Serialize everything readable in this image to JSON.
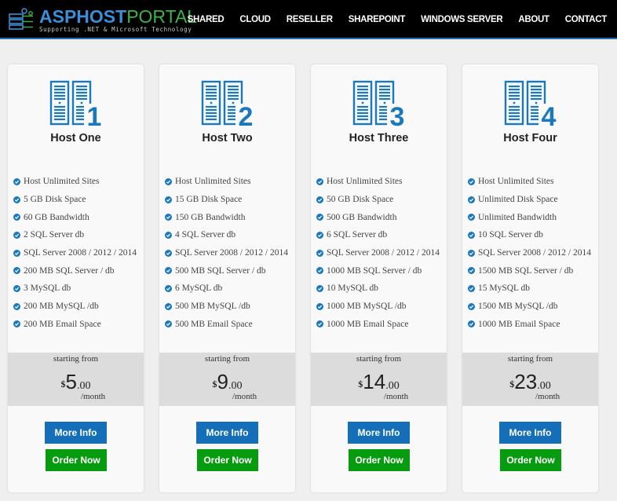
{
  "header": {
    "logo": {
      "part1": "ASPHOST",
      "part2": "PORTAL",
      "tagline": "Supporting .NET & Microsoft Technology",
      "icon": "server-gear-icon"
    },
    "nav": [
      "SHARED",
      "CLOUD",
      "RESELLER",
      "SHAREPOINT",
      "WINDOWS SERVER",
      "ABOUT",
      "CONTACT"
    ]
  },
  "colors": {
    "brand_blue": "#3a8fd8",
    "brand_green": "#3cb34a",
    "more_info_button": "#146fb8",
    "order_now_button": "#079b0f",
    "check_icon": "#1a78be"
  },
  "plans": [
    {
      "number": "1",
      "title": "Host One",
      "features": [
        "Host Unlimited Sites",
        "5 GB Disk Space",
        "60 GB Bandwidth",
        "2 SQL Server db",
        "SQL Server 2008 / 2012 / 2014",
        "200 MB SQL Server / db",
        "3 MySQL db",
        "200 MB MySQL /db",
        "200 MB Email Space"
      ],
      "starting_label": "starting from",
      "currency": "$",
      "amount": "5",
      "decimals": ".00",
      "period": "/month",
      "more_info": "More Info",
      "order_now": "Order Now"
    },
    {
      "number": "2",
      "title": "Host Two",
      "features": [
        "Host Unlimited Sites",
        "15 GB Disk Space",
        "150 GB Bandwidth",
        "4 SQL Server db",
        "SQL Server 2008 / 2012 / 2014",
        "500 MB SQL Server / db",
        "6 MySQL db",
        "500 MB MySQL /db",
        "500 MB Email Space"
      ],
      "starting_label": "starting from",
      "currency": "$",
      "amount": "9",
      "decimals": ".00",
      "period": "/month",
      "more_info": "More Info",
      "order_now": "Order Now"
    },
    {
      "number": "3",
      "title": "Host Three",
      "features": [
        "Host Unlimited Sites",
        "50 GB Disk Space",
        "500 GB Bandwidth",
        "6 SQL Server db",
        "SQL Server 2008 / 2012 / 2014",
        "1000 MB SQL Server / db",
        "10 MySQL db",
        "1000 MB MySQL /db",
        "1000 MB Email Space"
      ],
      "starting_label": "starting from",
      "currency": "$",
      "amount": "14",
      "decimals": ".00",
      "period": "/month",
      "more_info": "More Info",
      "order_now": "Order Now"
    },
    {
      "number": "4",
      "title": "Host Four",
      "features": [
        "Host Unlimited Sites",
        "Unlimited Disk Space",
        "Unlimited Bandwidth",
        "10 SQL Server db",
        "SQL Server 2008 / 2012 / 2014",
        "1500 MB SQL Server / db",
        "15 MySQL db",
        "1500 MB MySQL /db",
        "1000 MB Email Space"
      ],
      "starting_label": "starting from",
      "currency": "$",
      "amount": "23",
      "decimals": ".00",
      "period": "/month",
      "more_info": "More Info",
      "order_now": "Order Now"
    }
  ]
}
